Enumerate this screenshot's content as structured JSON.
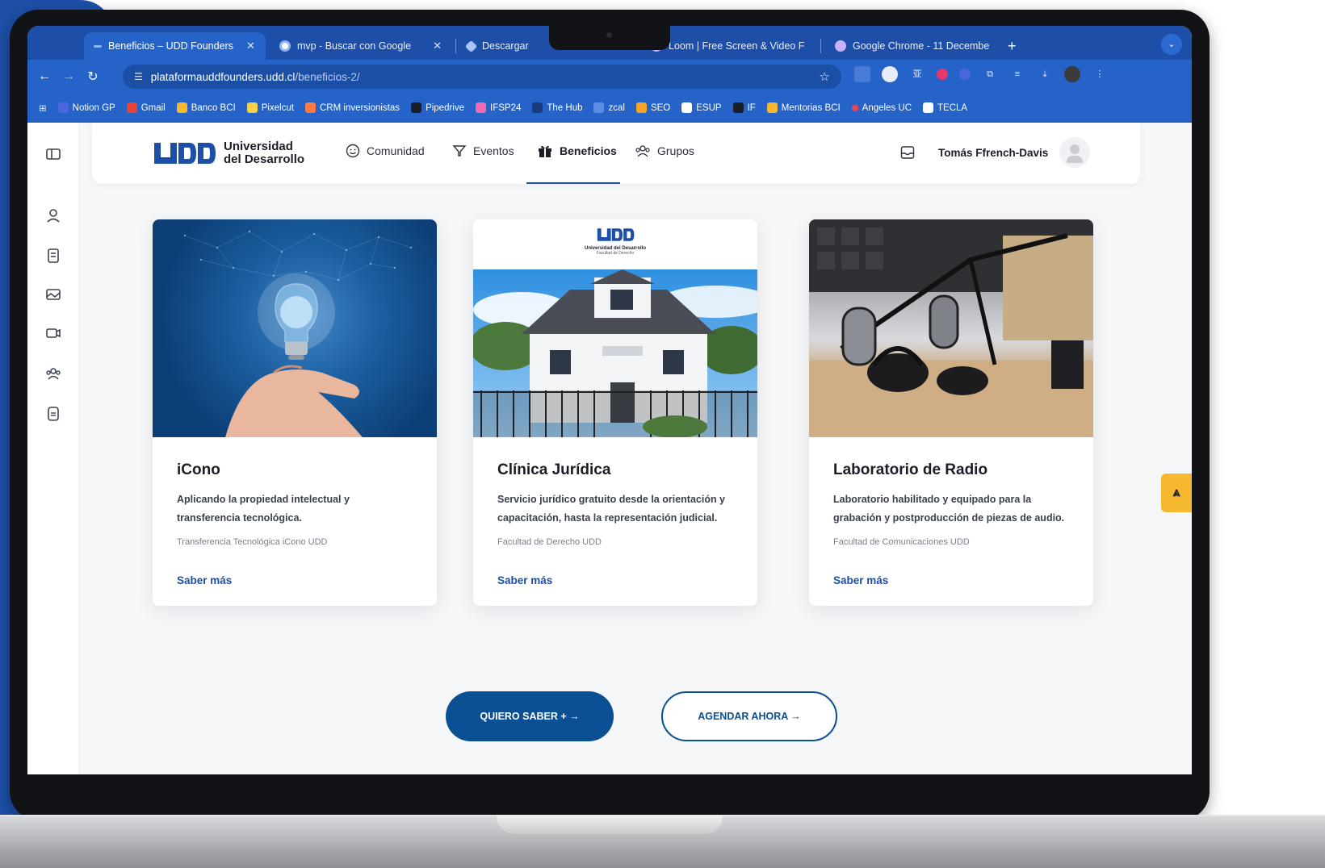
{
  "browser": {
    "tabs": [
      {
        "label": "Beneficios – UDD Founders",
        "active": true
      },
      {
        "label": "mvp - Buscar con Google",
        "active": false
      },
      {
        "label": "Descargar",
        "active": false
      },
      {
        "label": "Loom | Free Screen & Video F",
        "active": false
      },
      {
        "label": "Google Chrome - 11 Decembe",
        "active": false
      }
    ],
    "new_tab": "+",
    "url_host": "plataformauddfounders.udd.cl",
    "url_path": "/beneficios-2/",
    "bookmarks": [
      "Notion GP",
      "Gmail",
      "Banco BCI",
      "Pixelcut",
      "CRM inversionistas",
      "Pipedrive",
      "IFSP24",
      "The Hub",
      "zcal",
      "SEO",
      "ESUP",
      "IF",
      "Mentorias BCI",
      "Angeles UC",
      "TECLA"
    ]
  },
  "site": {
    "logo_line1": "Universidad",
    "logo_line2": "del Desarrollo",
    "nav": [
      {
        "label": "Comunidad",
        "icon": "smile-icon"
      },
      {
        "label": "Eventos",
        "icon": "filter-icon"
      },
      {
        "label": "Beneficios",
        "icon": "gift-icon",
        "active": true
      },
      {
        "label": "Grupos",
        "icon": "group-icon"
      }
    ],
    "user_name": "Tomás Ffrench-Davis"
  },
  "cards": [
    {
      "title": "iCono",
      "description": "Aplicando la propiedad intelectual y transferencia tecnológica.",
      "source": "Transferencia Tecnológica iCono UDD",
      "link": "Saber más"
    },
    {
      "title": "Clínica Jurídica",
      "description": "Servicio jurídico gratuito desde la orientación y capacitación, hasta la representación judicial.",
      "source": "Facultad de Derecho UDD",
      "link": "Saber más",
      "image_caption": "Universidad del Desarrollo",
      "image_caption2": "Facultad de Derecho"
    },
    {
      "title": "Laboratorio de Radio",
      "description": "Laboratorio habilitado y equipado para la grabación y postproducción de piezas de audio.",
      "source": "Facultad de Comunicaciones UDD",
      "link": "Saber más"
    }
  ],
  "actions": {
    "primary": "QUIERO SABER + →",
    "secondary": "AGENDAR AHORA →"
  },
  "colors": {
    "brand_blue": "#1d4fa8",
    "button_blue": "#0b4f94",
    "scroll_top_yellow": "#f5b82e"
  }
}
